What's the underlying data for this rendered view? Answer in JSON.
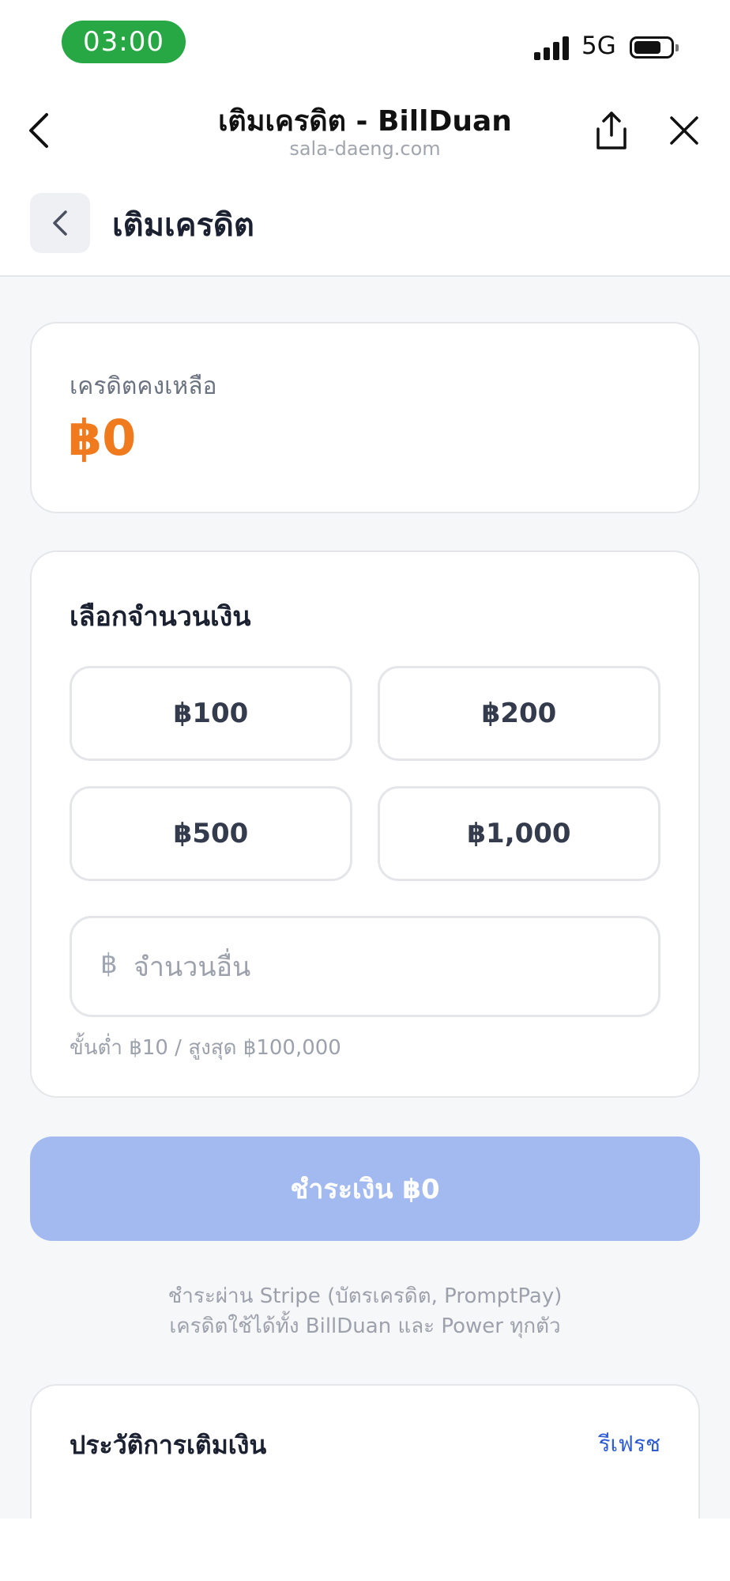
{
  "status_bar": {
    "time": "03:00",
    "network": "5G"
  },
  "browser": {
    "title": "เติมเครดิต - BillDuan",
    "url": "sala-daeng.com"
  },
  "page": {
    "title": "เติมเครดิต"
  },
  "balance": {
    "label": "เครดิตคงเหลือ",
    "value": "฿0",
    "accent_color": "#f07a1e"
  },
  "amount": {
    "title": "เลือกจำนวนเงิน",
    "options": [
      "฿100",
      "฿200",
      "฿500",
      "฿1,000"
    ],
    "custom_currency": "฿",
    "custom_placeholder": "จำนวนอื่น",
    "limits": "ขั้นต่ำ ฿10 / สูงสุด ฿100,000"
  },
  "pay": {
    "label": "ชำระเงิน ฿0",
    "note_line1": "ชำระผ่าน Stripe (บัตรเครดิต, PromptPay)",
    "note_line2": "เครดิตใช้ได้ทั้ง BillDuan และ Power ทุกตัว"
  },
  "history": {
    "title": "ประวัติการเติมเงิน",
    "refresh_label": "รีเฟรช"
  }
}
